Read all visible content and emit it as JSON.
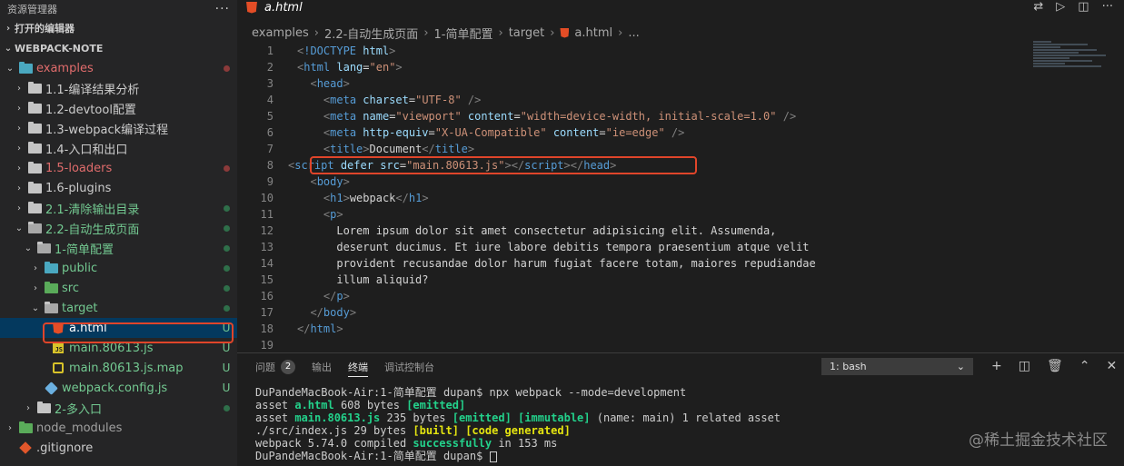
{
  "sidebar": {
    "title": "资源管理器",
    "more": "···",
    "open_editors": "打开的编辑器",
    "workspace": "WEBPACK-NOTE",
    "items": [
      {
        "label": "examples",
        "badge": ""
      },
      {
        "label": "1.1-编译结果分析",
        "badge": ""
      },
      {
        "label": "1.2-devtool配置",
        "badge": ""
      },
      {
        "label": "1.3-webpack编译过程",
        "badge": ""
      },
      {
        "label": "1.4-入口和出口",
        "badge": ""
      },
      {
        "label": "1.5-loaders",
        "badge": ""
      },
      {
        "label": "1.6-plugins",
        "badge": ""
      },
      {
        "label": "2.1-清除输出目录",
        "badge": ""
      },
      {
        "label": "2.2-自动生成页面",
        "badge": ""
      },
      {
        "label": "1-简单配置",
        "badge": ""
      },
      {
        "label": "public",
        "badge": ""
      },
      {
        "label": "src",
        "badge": ""
      },
      {
        "label": "target",
        "badge": ""
      },
      {
        "label": "a.html",
        "badge": "U"
      },
      {
        "label": "main.80613.js",
        "badge": "U"
      },
      {
        "label": "main.80613.js.map",
        "badge": "U"
      },
      {
        "label": "webpack.config.js",
        "badge": "U"
      },
      {
        "label": "2-多入口",
        "badge": ""
      },
      {
        "label": "node_modules",
        "badge": ""
      },
      {
        "label": ".gitignore",
        "badge": ""
      }
    ]
  },
  "editor": {
    "tab": "a.html",
    "breadcrumb": [
      "examples",
      "2.2-自动生成页面",
      "1-简单配置",
      "target",
      "a.html",
      "..."
    ],
    "line_numbers": [
      "1",
      "2",
      "3",
      "4",
      "5",
      "6",
      "7",
      "8",
      "9",
      "10",
      "11",
      "12",
      "13",
      "14",
      "15",
      "16",
      "17",
      "18",
      "19"
    ],
    "code": {
      "l1": {
        "open": "<",
        "kw": "!DOCTYPE",
        "rest": " html",
        "close": ">"
      },
      "l2_tag": "html",
      "l2_attr": "lang",
      "l2_val": "\"en\"",
      "l3_tag": "head",
      "l4_tag": "meta",
      "l4_attr": "charset",
      "l4_val": "\"UTF-8\"",
      "l5_tag": "meta",
      "l5_attr1": "name",
      "l5_val1": "\"viewport\"",
      "l5_attr2": "content",
      "l5_val2": "\"width=device-width, initial-scale=1.0\"",
      "l6_tag": "meta",
      "l6_attr1": "http-equiv",
      "l6_val1": "\"X-UA-Compatible\"",
      "l6_attr2": "content",
      "l6_val2": "\"ie=edge\"",
      "l7_tag": "title",
      "l7_text": "Document",
      "l8_tag": "script",
      "l8_attr1": "defer",
      "l8_attr2": "src",
      "l8_val": "\"main.80613.js\"",
      "l8_close1": "script",
      "l8_close2": "head",
      "l9_tag": "body",
      "l10_tag": "h1",
      "l10_text": "webpack",
      "l11_tag": "p",
      "l12": "Lorem ipsum dolor sit amet consectetur adipisicing elit. Assumenda,",
      "l13": "deserunt ducimus. Et iure labore debitis tempora praesentium atque velit",
      "l14": "provident recusandae dolor harum fugiat facere totam, maiores repudiandae",
      "l15": "illum aliquid?",
      "l16_tag": "p",
      "l17_tag": "body",
      "l18_tag": "html"
    }
  },
  "panel": {
    "tabs": {
      "problems": "问题",
      "problems_count": "2",
      "output": "输出",
      "terminal": "终端",
      "debug": "调试控制台"
    },
    "terminal_select": "1: bash",
    "terminal": {
      "l1": "DuPandeMacBook-Air:1-简单配置 dupan$ npx webpack --mode=development",
      "l2a": "asset ",
      "l2b": "a.html",
      "l2c": " 608 bytes ",
      "l2d": "[emitted]",
      "l3a": "asset ",
      "l3b": "main.80613.js",
      "l3c": " 235 bytes ",
      "l3d": "[emitted]",
      "l3e": " ",
      "l3f": "[immutable]",
      "l3g": " (name: main) 1 related asset",
      "l4a": "./src/index.js 29 bytes ",
      "l4b": "[built]",
      "l4c": " ",
      "l4d": "[code generated]",
      "l5a": "webpack 5.74.0 compiled ",
      "l5b": "successfully",
      "l5c": " in 153 ms",
      "l6": "DuPandeMacBook-Air:1-简单配置 dupan$ "
    }
  },
  "watermark": "@稀土掘金技术社区"
}
